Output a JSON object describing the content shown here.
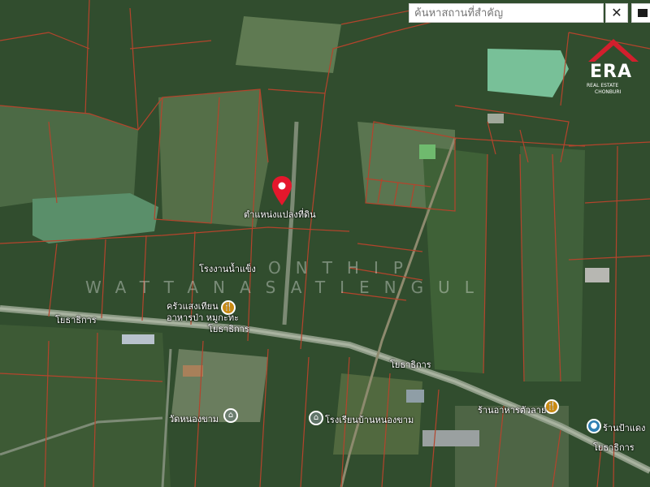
{
  "search": {
    "placeholder": "ค้นหาสถานที่สำคัญ",
    "clear_symbol": "✕"
  },
  "marker": {
    "label": "ตำแหน่งแปลงที่ดิน",
    "color": "#e5172c"
  },
  "logo": {
    "brand": "ERA",
    "subtitle": "REAL ESTATE",
    "region": "CHONBURI",
    "color": "#d21f2d"
  },
  "watermark": {
    "line1": "ONTHIP",
    "line2": "WATTANASATIENGUL"
  },
  "roads": {
    "label_1": "โยธาธิการ",
    "label_2": "โยธาธิการ",
    "label_3": "โยธาธิการ",
    "label_4": "โยธาธิการ"
  },
  "places": {
    "poi_1": "โรงงานน้ำแข็ง",
    "poi_2": "ครัวแสงเทียน",
    "poi_3": "อาหารป่า หมูกะทะ",
    "poi_4": "วัดหนองขาม",
    "poi_5": "โรงเรียนบ้านหนองขาม",
    "poi_6": "ร้านอาหารตัวลาย",
    "poi_7": "ร้านป้าแดง"
  },
  "colors": {
    "parcel_line": "#b4442c",
    "ponds": "#5a8f6a",
    "vegetation": "#2e4d29"
  }
}
